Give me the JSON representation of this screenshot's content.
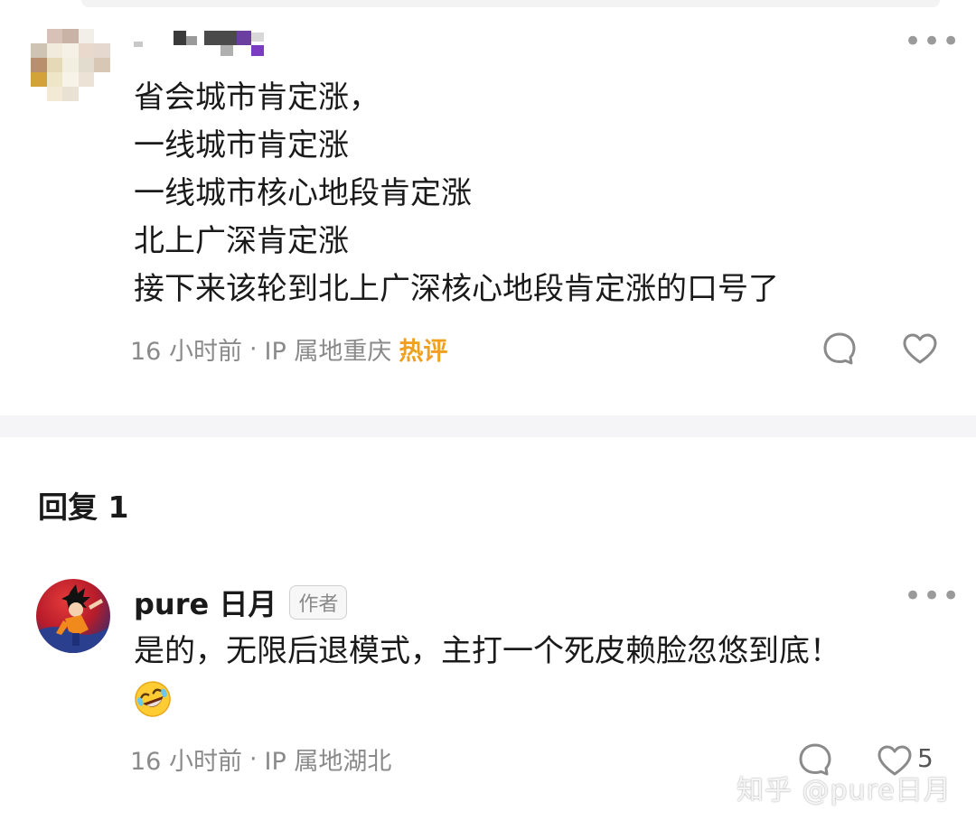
{
  "comment": {
    "lines": [
      "省会城市肯定涨，",
      "一线城市肯定涨",
      "一线城市核心地段肯定涨",
      "北上广深肯定涨",
      "接下来该轮到北上广深核心地段肯定涨的口号了"
    ],
    "time": "16 小时前",
    "separator": "·",
    "ip": "IP 属地重庆",
    "hot_label": "热评",
    "more_label": "•••"
  },
  "replies": {
    "heading": "回复 1",
    "items": [
      {
        "author": "pure 日月",
        "badge": "作者",
        "text": "是的，无限后退模式，主打一个死皮赖脸忽悠到底！",
        "time": "16 小时前",
        "separator": "·",
        "ip": "IP 属地湖北",
        "like_count": "5",
        "more_label": "•••"
      }
    ]
  },
  "watermark": "知乎 @pure日月",
  "colors": {
    "hot": "#f0a020",
    "meta": "#8a8a8a",
    "divider": "#f5f5f7"
  },
  "icons": [
    "comment-bubble-icon",
    "heart-icon",
    "more-dots-icon",
    "rofl-emoji-icon"
  ]
}
